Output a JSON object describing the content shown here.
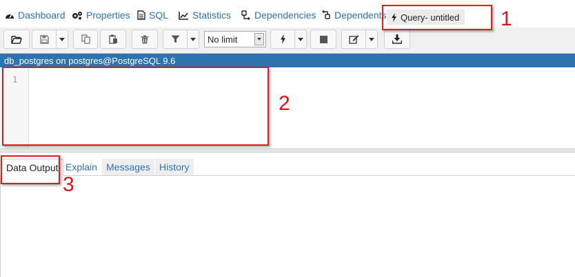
{
  "tabs": [
    {
      "label": "Dashboard",
      "icon": "dashboard-icon"
    },
    {
      "label": "Properties",
      "icon": "cogs-icon"
    },
    {
      "label": "SQL",
      "icon": "file-icon"
    },
    {
      "label": "Statistics",
      "icon": "line-chart-icon"
    },
    {
      "label": "Dependencies",
      "icon": "dependencies-icon"
    },
    {
      "label": "Dependents",
      "icon": "dependents-icon"
    },
    {
      "label": "Query- untitled",
      "icon": "bolt-icon"
    }
  ],
  "toolbar": {
    "limit_value": "No limit",
    "icons": [
      "folder-open-icon",
      "save-icon",
      "copy-icon",
      "paste-icon",
      "trash-icon",
      "filter-icon",
      "execute-icon",
      "stop-icon",
      "edit-icon",
      "download-icon"
    ]
  },
  "connection": {
    "label": "db_postgres on postgres@PostgreSQL 9.6"
  },
  "editor": {
    "line_numbers": [
      "1"
    ]
  },
  "result_tabs": [
    "Data Output",
    "Explain",
    "Messages",
    "History"
  ],
  "annotations": [
    "1",
    "2",
    "3"
  ],
  "colors": {
    "accent": "#2c73b0",
    "annotation": "#e01b1b"
  }
}
